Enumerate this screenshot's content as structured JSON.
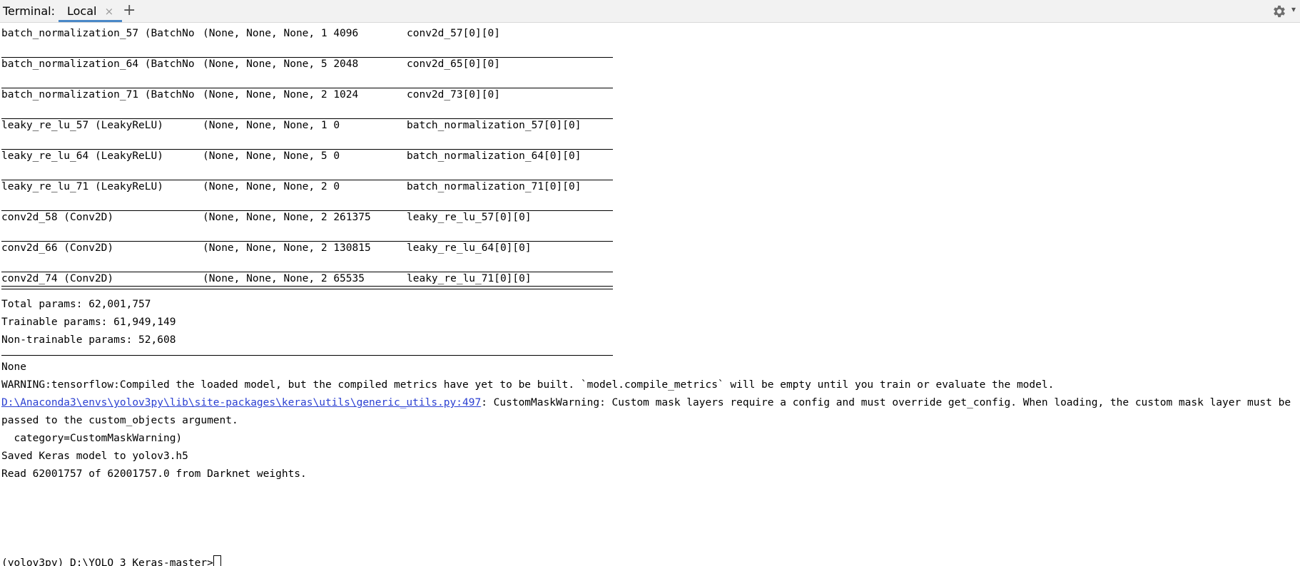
{
  "tabbar": {
    "label": "Terminal:",
    "tab": {
      "label": "Local",
      "close": "×"
    },
    "add": "+",
    "settings_icon": "gear-icon",
    "menu_icon": "chevron-down-icon"
  },
  "layers": [
    {
      "name": "batch_normalization_57 (BatchNo",
      "shape": "(None, None, None, 1 4096",
      "connected": "conv2d_57[0][0]"
    },
    {
      "name": "batch_normalization_64 (BatchNo",
      "shape": "(None, None, None, 5 2048",
      "connected": "conv2d_65[0][0]"
    },
    {
      "name": "batch_normalization_71 (BatchNo",
      "shape": "(None, None, None, 2 1024",
      "connected": "conv2d_73[0][0]"
    },
    {
      "name": "leaky_re_lu_57 (LeakyReLU)",
      "shape": "(None, None, None, 1 0",
      "connected": "batch_normalization_57[0][0]"
    },
    {
      "name": "leaky_re_lu_64 (LeakyReLU)",
      "shape": "(None, None, None, 5 0",
      "connected": "batch_normalization_64[0][0]"
    },
    {
      "name": "leaky_re_lu_71 (LeakyReLU)",
      "shape": "(None, None, None, 2 0",
      "connected": "batch_normalization_71[0][0]"
    },
    {
      "name": "conv2d_58 (Conv2D)",
      "shape": "(None, None, None, 2 261375",
      "connected": "leaky_re_lu_57[0][0]"
    },
    {
      "name": "conv2d_66 (Conv2D)",
      "shape": "(None, None, None, 2 130815",
      "connected": "leaky_re_lu_64[0][0]"
    },
    {
      "name": "conv2d_74 (Conv2D)",
      "shape": "(None, None, None, 2 65535",
      "connected": "leaky_re_lu_71[0][0]"
    }
  ],
  "summary": {
    "total": "Total params: 62,001,757",
    "trainable": "Trainable params: 61,949,149",
    "non_trainable": "Non-trainable params: 52,608"
  },
  "output": {
    "none": "None",
    "warning": "WARNING:tensorflow:Compiled the loaded model, but the compiled metrics have yet to be built. `model.compile_metrics` will be empty until you train or evaluate the model.",
    "path_link": "D:\\Anaconda3\\envs\\yolov3py\\lib\\site-packages\\keras\\utils\\generic_utils.py:497",
    "warning2_rest": ": CustomMaskWarning: Custom mask layers require a config and must override get_config. When loading, the custom mask layer must be",
    "warning2_cont": "passed to the custom_objects argument.",
    "category": "  category=CustomMaskWarning)",
    "saved": "Saved Keras model to yolov3.h5",
    "read": "Read 62001757 of 62001757.0 from Darknet weights."
  },
  "prompt": {
    "text": "(yolov3py) D:\\YOLO_3_Keras-master>"
  }
}
